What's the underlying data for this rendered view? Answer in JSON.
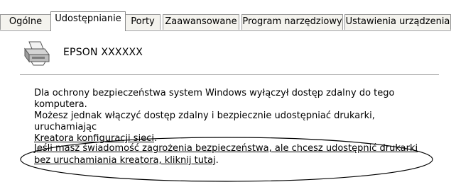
{
  "tabs": [
    {
      "label": "Ogólne",
      "active": false
    },
    {
      "label": "Udostępnianie",
      "active": true
    },
    {
      "label": "Porty",
      "active": false
    },
    {
      "label": "Zaawansowane",
      "active": false
    },
    {
      "label": "Program narzędziowy",
      "active": false
    },
    {
      "label": "Ustawienia urządzenia",
      "active": false
    }
  ],
  "printer": {
    "icon": "printer-icon",
    "name": "EPSON XXXXXX"
  },
  "info": {
    "line1": "Dla ochrony bezpieczeństwa system Windows wyłączył dostęp zdalny do tego komputera.",
    "line2": "Możesz jednak włączyć dostęp zdalny i bezpiecznie udostępniać drukarki, uruchamiając",
    "wizard_link": "Kreatora konfiguracji sieci",
    "wizard_suffix": "."
  },
  "bypass_link": "Jeśli masz świadomość zagrożenia bezpieczeństwa, ale chcesz udostępnić drukarki bez uruchamiania kreatora, kliknij tutaj",
  "bypass_suffix": ".",
  "colors": {
    "tab_border": "#9a9a9a",
    "tab_bg": "#f4f3ee",
    "highlight_ellipse": "#000000"
  }
}
